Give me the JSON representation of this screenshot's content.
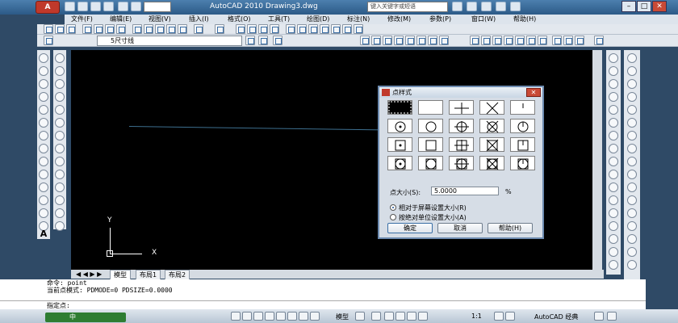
{
  "app": {
    "logo": "A",
    "title": "AutoCAD 2010    Drawing3.dwg",
    "workspace": "",
    "search_placeholder": "键入关键字或短语"
  },
  "menu": [
    "文件(F)",
    "编辑(E)",
    "视图(V)",
    "插入(I)",
    "格式(O)",
    "工具(T)",
    "绘图(D)",
    "标注(N)",
    "修改(M)",
    "参数(P)",
    "窗口(W)",
    "帮助(H)"
  ],
  "toolbar": {
    "layer_value": "5尺寸线"
  },
  "canvas": {
    "ucs_x": "X",
    "ucs_y": "Y"
  },
  "tabs": [
    "模型",
    "布局1",
    "布局2"
  ],
  "tab_nav": "◀ ◀ ▶ ▶",
  "command": {
    "lines": [
      "命令:  point",
      "当前点模式:  PDMODE=0  PDSIZE=0.0000"
    ],
    "prompt": "指定点:"
  },
  "status": {
    "model_label": "模型",
    "scale": "1:1",
    "workspace": "AutoCAD 经典",
    "ime": "中"
  },
  "dialog": {
    "title": "点样式",
    "close": "✕",
    "size_label": "点大小(S):",
    "size_value": "5.0000",
    "pct": "%",
    "option_relative": "相对于屏幕设置大小(R)",
    "option_absolute": "按绝对单位设置大小(A)",
    "ok": "确定",
    "cancel": "取消",
    "help": "帮助(H)",
    "selected_index": 0
  },
  "colors": {
    "accent": "#3a6ea5",
    "canvas": "#000000",
    "line": "#3d6f8f"
  }
}
